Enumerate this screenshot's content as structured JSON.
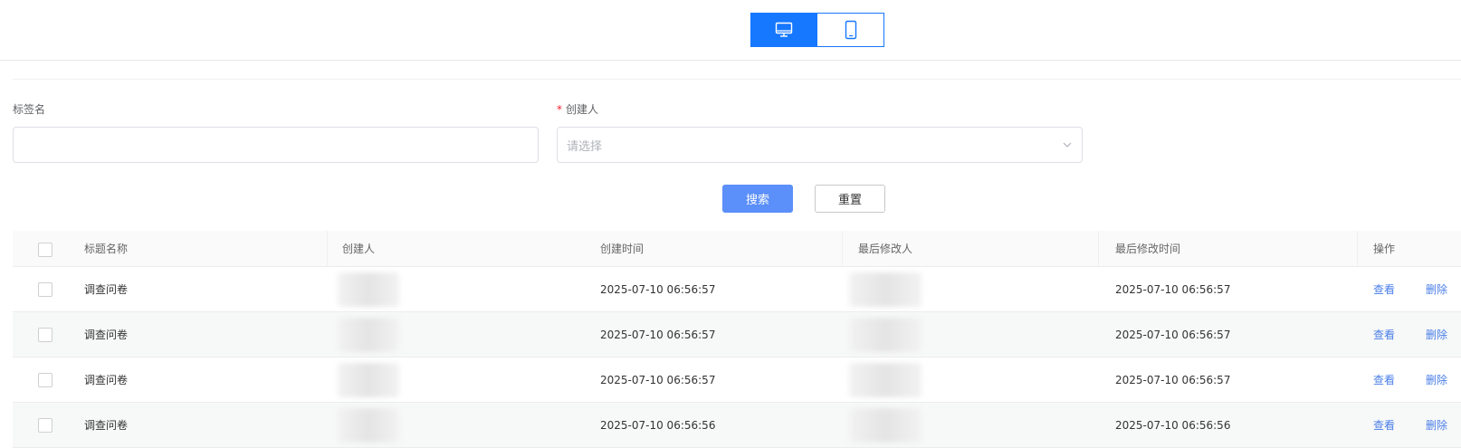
{
  "view_toggle": {
    "desktop_icon": "desktop-monitor-icon",
    "mobile_icon": "mobile-phone-icon",
    "active": "desktop"
  },
  "filters": {
    "tag_name": {
      "label": "标签名",
      "value": "",
      "placeholder": ""
    },
    "creator": {
      "label": "创建人",
      "required_mark": "*",
      "placeholder": "请选择",
      "icon": "chevron-down-icon"
    }
  },
  "buttons": {
    "search": "搜索",
    "reset": "重置"
  },
  "table": {
    "columns": [
      "标题名称",
      "创建人",
      "创建时间",
      "最后修改人",
      "最后修改时间",
      "操作"
    ],
    "rows": [
      {
        "title": "调查问卷",
        "created_at": "2025-07-10 06:56:57",
        "modified_at": "2025-07-10 06:56:57",
        "actions": [
          "查看",
          "删除"
        ]
      },
      {
        "title": "调查问卷",
        "created_at": "2025-07-10 06:56:57",
        "modified_at": "2025-07-10 06:56:57",
        "actions": [
          "查看",
          "删除"
        ]
      },
      {
        "title": "调查问卷",
        "created_at": "2025-07-10 06:56:57",
        "modified_at": "2025-07-10 06:56:57",
        "actions": [
          "查看",
          "删除"
        ]
      },
      {
        "title": "调查问卷",
        "created_at": "2025-07-10 06:56:56",
        "modified_at": "2025-07-10 06:56:56",
        "actions": [
          "查看",
          "删除"
        ]
      }
    ]
  },
  "colors": {
    "primary": "#1677ff",
    "search_button": "#5b8ff9",
    "link": "#4a7ee8",
    "required": "#f5222d"
  }
}
